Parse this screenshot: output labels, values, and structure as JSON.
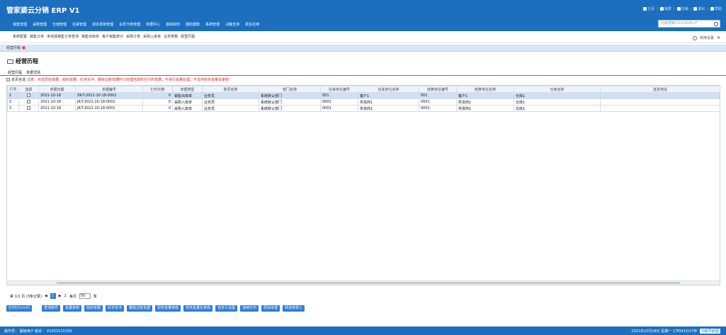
{
  "app": {
    "title": "管家婆云分销 ERP V1"
  },
  "toplinks": [
    "主页",
    "锁屏",
    "注销",
    "退出",
    "帮助"
  ],
  "menu": [
    "销售管理",
    "采购管理",
    "仓储管理",
    "往来管理",
    "成本费用管理",
    "会员卡券管理",
    "单据中心",
    "基础资料",
    "期初建账",
    "系统管理",
    "决策支持",
    "更多应用"
  ],
  "search": {
    "placeholder": "功能搜索Ctrl+Shift+F"
  },
  "subnav": {
    "items": [
      "系统配置",
      "销售订单",
      "未完成销售订单查询",
      "销售出库单",
      "客户销售统计",
      "采购订单",
      "采购入库单",
      "业务草稿",
      "经营历程"
    ],
    "settings": "常用设置"
  },
  "tab": {
    "label": "经营历程"
  },
  "page": {
    "title": "经营历程",
    "subtabs": [
      "经营历程",
      "单据详情"
    ]
  },
  "notice": {
    "selectall": "本页全选",
    "text": "注意：点击原始单据、组织单据、红字反冲、删除过账单据时只处理当前所在行的单据，不进行批量处理，不支持财务批量反审核！"
  },
  "table": {
    "headers": [
      "行号",
      "选择",
      "单据日期",
      "单据编号",
      "打印次数",
      "单据类型",
      "职员名称",
      "部门名称",
      "往来单位编号",
      "往来单位名称",
      "结算单位编号",
      "结算单位名称",
      "仓库名称",
      "送货地址"
    ],
    "rows": [
      [
        "1",
        "",
        "2021-10-18",
        "XK-T-2021-10-18-0002",
        "0",
        "销售出库单",
        "业务员",
        "系统默认部门",
        "001",
        "客户1",
        "001",
        "客户1",
        "仓库1",
        ""
      ],
      [
        "2",
        "",
        "2021-10-18",
        "JK-T-2021-10-18-0002",
        "0",
        "采购入库单",
        "业务员",
        "系统默认部门",
        "0001",
        "供货商1",
        "0001",
        "供货商1",
        "仓库1",
        ""
      ],
      [
        "3",
        "",
        "2021-10-18",
        "JK-T-2021-10-18-0001",
        "0",
        "采购入库单",
        "业务员",
        "系统默认部门",
        "0001",
        "供货商1",
        "0001",
        "供货商1",
        "仓库1",
        ""
      ]
    ]
  },
  "pager": {
    "info": "第 1/1 页 (3条记录)",
    "current": "1",
    "next": "2",
    "perpage_label": "每页",
    "perpage": "50",
    "unit": "条"
  },
  "buttons": [
    "打印(Ctrl+P)",
    "查询条件",
    "批量复制",
    "组织单据",
    "红字反冲",
    "删除过账单据",
    "财务批量审核",
    "财务批量反审核",
    "自定义设置",
    "连续打印",
    "原始单据",
    "转选到单入"
  ],
  "status": {
    "left": "操作员： 超级用户   版本： V1202110158",
    "right": "2021年10月18日 星期一 17时42分27秒",
    "nav": "功能导航图"
  }
}
